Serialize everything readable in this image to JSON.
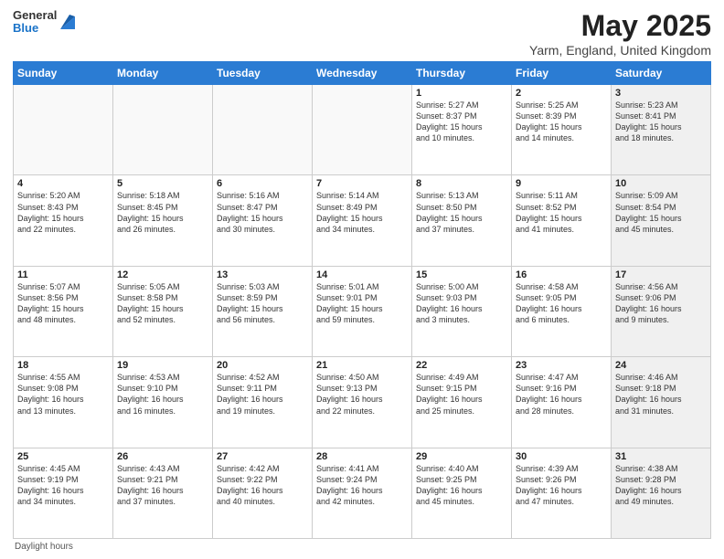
{
  "header": {
    "logo_general": "General",
    "logo_blue": "Blue",
    "title": "May 2025",
    "subtitle": "Yarm, England, United Kingdom"
  },
  "columns": [
    "Sunday",
    "Monday",
    "Tuesday",
    "Wednesday",
    "Thursday",
    "Friday",
    "Saturday"
  ],
  "rows": [
    [
      {
        "day": "",
        "info": "",
        "shaded": true
      },
      {
        "day": "",
        "info": "",
        "shaded": true
      },
      {
        "day": "",
        "info": "",
        "shaded": true
      },
      {
        "day": "",
        "info": "",
        "shaded": true
      },
      {
        "day": "1",
        "info": "Sunrise: 5:27 AM\nSunset: 8:37 PM\nDaylight: 15 hours\nand 10 minutes.",
        "shaded": false
      },
      {
        "day": "2",
        "info": "Sunrise: 5:25 AM\nSunset: 8:39 PM\nDaylight: 15 hours\nand 14 minutes.",
        "shaded": false
      },
      {
        "day": "3",
        "info": "Sunrise: 5:23 AM\nSunset: 8:41 PM\nDaylight: 15 hours\nand 18 minutes.",
        "shaded": true
      }
    ],
    [
      {
        "day": "4",
        "info": "Sunrise: 5:20 AM\nSunset: 8:43 PM\nDaylight: 15 hours\nand 22 minutes.",
        "shaded": false
      },
      {
        "day": "5",
        "info": "Sunrise: 5:18 AM\nSunset: 8:45 PM\nDaylight: 15 hours\nand 26 minutes.",
        "shaded": false
      },
      {
        "day": "6",
        "info": "Sunrise: 5:16 AM\nSunset: 8:47 PM\nDaylight: 15 hours\nand 30 minutes.",
        "shaded": false
      },
      {
        "day": "7",
        "info": "Sunrise: 5:14 AM\nSunset: 8:49 PM\nDaylight: 15 hours\nand 34 minutes.",
        "shaded": false
      },
      {
        "day": "8",
        "info": "Sunrise: 5:13 AM\nSunset: 8:50 PM\nDaylight: 15 hours\nand 37 minutes.",
        "shaded": false
      },
      {
        "day": "9",
        "info": "Sunrise: 5:11 AM\nSunset: 8:52 PM\nDaylight: 15 hours\nand 41 minutes.",
        "shaded": false
      },
      {
        "day": "10",
        "info": "Sunrise: 5:09 AM\nSunset: 8:54 PM\nDaylight: 15 hours\nand 45 minutes.",
        "shaded": true
      }
    ],
    [
      {
        "day": "11",
        "info": "Sunrise: 5:07 AM\nSunset: 8:56 PM\nDaylight: 15 hours\nand 48 minutes.",
        "shaded": false
      },
      {
        "day": "12",
        "info": "Sunrise: 5:05 AM\nSunset: 8:58 PM\nDaylight: 15 hours\nand 52 minutes.",
        "shaded": false
      },
      {
        "day": "13",
        "info": "Sunrise: 5:03 AM\nSunset: 8:59 PM\nDaylight: 15 hours\nand 56 minutes.",
        "shaded": false
      },
      {
        "day": "14",
        "info": "Sunrise: 5:01 AM\nSunset: 9:01 PM\nDaylight: 15 hours\nand 59 minutes.",
        "shaded": false
      },
      {
        "day": "15",
        "info": "Sunrise: 5:00 AM\nSunset: 9:03 PM\nDaylight: 16 hours\nand 3 minutes.",
        "shaded": false
      },
      {
        "day": "16",
        "info": "Sunrise: 4:58 AM\nSunset: 9:05 PM\nDaylight: 16 hours\nand 6 minutes.",
        "shaded": false
      },
      {
        "day": "17",
        "info": "Sunrise: 4:56 AM\nSunset: 9:06 PM\nDaylight: 16 hours\nand 9 minutes.",
        "shaded": true
      }
    ],
    [
      {
        "day": "18",
        "info": "Sunrise: 4:55 AM\nSunset: 9:08 PM\nDaylight: 16 hours\nand 13 minutes.",
        "shaded": false
      },
      {
        "day": "19",
        "info": "Sunrise: 4:53 AM\nSunset: 9:10 PM\nDaylight: 16 hours\nand 16 minutes.",
        "shaded": false
      },
      {
        "day": "20",
        "info": "Sunrise: 4:52 AM\nSunset: 9:11 PM\nDaylight: 16 hours\nand 19 minutes.",
        "shaded": false
      },
      {
        "day": "21",
        "info": "Sunrise: 4:50 AM\nSunset: 9:13 PM\nDaylight: 16 hours\nand 22 minutes.",
        "shaded": false
      },
      {
        "day": "22",
        "info": "Sunrise: 4:49 AM\nSunset: 9:15 PM\nDaylight: 16 hours\nand 25 minutes.",
        "shaded": false
      },
      {
        "day": "23",
        "info": "Sunrise: 4:47 AM\nSunset: 9:16 PM\nDaylight: 16 hours\nand 28 minutes.",
        "shaded": false
      },
      {
        "day": "24",
        "info": "Sunrise: 4:46 AM\nSunset: 9:18 PM\nDaylight: 16 hours\nand 31 minutes.",
        "shaded": true
      }
    ],
    [
      {
        "day": "25",
        "info": "Sunrise: 4:45 AM\nSunset: 9:19 PM\nDaylight: 16 hours\nand 34 minutes.",
        "shaded": false
      },
      {
        "day": "26",
        "info": "Sunrise: 4:43 AM\nSunset: 9:21 PM\nDaylight: 16 hours\nand 37 minutes.",
        "shaded": false
      },
      {
        "day": "27",
        "info": "Sunrise: 4:42 AM\nSunset: 9:22 PM\nDaylight: 16 hours\nand 40 minutes.",
        "shaded": false
      },
      {
        "day": "28",
        "info": "Sunrise: 4:41 AM\nSunset: 9:24 PM\nDaylight: 16 hours\nand 42 minutes.",
        "shaded": false
      },
      {
        "day": "29",
        "info": "Sunrise: 4:40 AM\nSunset: 9:25 PM\nDaylight: 16 hours\nand 45 minutes.",
        "shaded": false
      },
      {
        "day": "30",
        "info": "Sunrise: 4:39 AM\nSunset: 9:26 PM\nDaylight: 16 hours\nand 47 minutes.",
        "shaded": false
      },
      {
        "day": "31",
        "info": "Sunrise: 4:38 AM\nSunset: 9:28 PM\nDaylight: 16 hours\nand 49 minutes.",
        "shaded": true
      }
    ]
  ],
  "footer": {
    "daylight_label": "Daylight hours"
  }
}
